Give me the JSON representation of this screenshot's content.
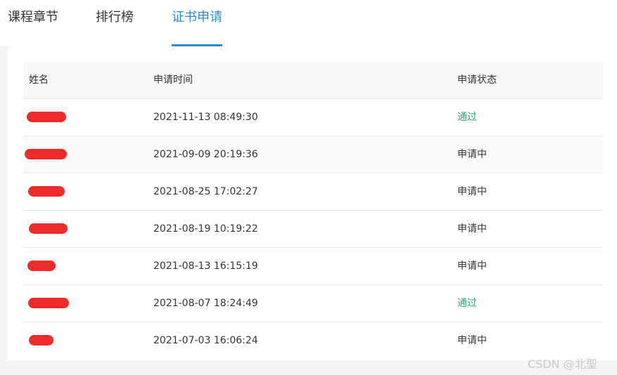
{
  "tabs": [
    {
      "label": "课程章节",
      "active": false
    },
    {
      "label": "排行榜",
      "active": false
    },
    {
      "label": "证书申请",
      "active": true
    }
  ],
  "table": {
    "headers": [
      "姓名",
      "申请时间",
      "申请状态"
    ],
    "rows": [
      {
        "name": "",
        "time": "2021-11-13 08:49:30",
        "status": "通过"
      },
      {
        "name": "",
        "time": "2021-09-09 20:19:36",
        "status": "申请中"
      },
      {
        "name": "",
        "time": "2021-08-25 17:02:27",
        "status": "申请中"
      },
      {
        "name": "",
        "time": "2021-08-19 10:19:22",
        "status": "申请中"
      },
      {
        "name": "",
        "time": "2021-08-13 16:15:19",
        "status": "申请中"
      },
      {
        "name": "",
        "time": "2021-08-07 18:24:49",
        "status": "通过"
      },
      {
        "name": "",
        "time": "2021-07-03 16:06:24",
        "status": "申请中"
      }
    ]
  },
  "colors": {
    "accent": "#2e8bd6",
    "status_pass": "#31a36b",
    "redaction": "#ee2b2b"
  },
  "watermark": "CSDN @北聖"
}
